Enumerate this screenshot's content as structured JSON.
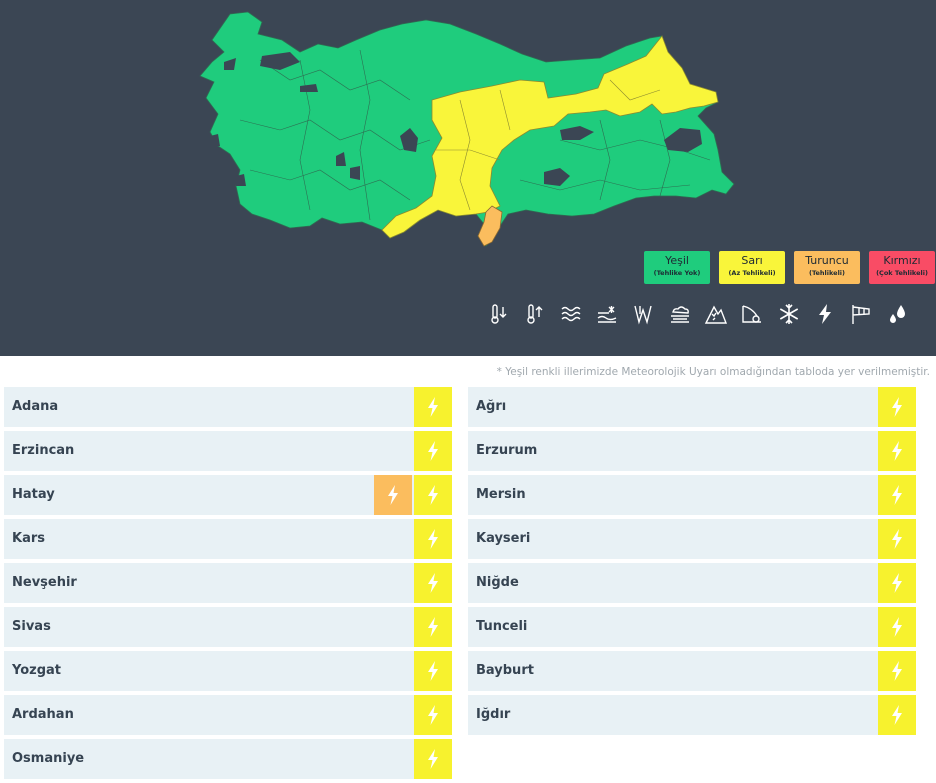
{
  "colors": {
    "panel": "#3b4654",
    "green": "#1fcc7d",
    "yellow": "#f9f53a",
    "orange": "#fbbd5e",
    "red": "#f94c65",
    "row_bg": "#e8f1f5"
  },
  "legend": [
    {
      "label": "Yeşil",
      "sub": "(Tehlike Yok)",
      "color": "#1fcc7d"
    },
    {
      "label": "Sarı",
      "sub": "(Az Tehlikeli)",
      "color": "#f9f53a"
    },
    {
      "label": "Turuncu",
      "sub": "(Tehlikeli)",
      "color": "#fbbd5e"
    },
    {
      "label": "Kırmızı",
      "sub": "(Çok Tehlikeli)",
      "color": "#f94c65"
    }
  ],
  "hazard_icons": [
    "cold-temperature-icon",
    "hot-temperature-icon",
    "wave-icon",
    "snow-melt-icon",
    "wind-icon",
    "fog-icon",
    "avalanche-icon",
    "dust-icon",
    "snow-icon",
    "thunderstorm-icon",
    "strong-wind-icon",
    "rain-icon"
  ],
  "note": "* Yeşil renkli illerimizde Meteorolojik Uyarı olmadığından tabloda yer verilmemiştir.",
  "provinces_left": [
    {
      "name": "Adana",
      "orange": false
    },
    {
      "name": "Erzincan",
      "orange": false
    },
    {
      "name": "Hatay",
      "orange": true
    },
    {
      "name": "Kars",
      "orange": false
    },
    {
      "name": "Nevşehir",
      "orange": false
    },
    {
      "name": "Sivas",
      "orange": false
    },
    {
      "name": "Yozgat",
      "orange": false
    },
    {
      "name": "Ardahan",
      "orange": false
    },
    {
      "name": "Osmaniye",
      "orange": false
    }
  ],
  "provinces_right": [
    {
      "name": "Ağrı",
      "orange": false
    },
    {
      "name": "Erzurum",
      "orange": false
    },
    {
      "name": "Mersin",
      "orange": false
    },
    {
      "name": "Kayseri",
      "orange": false
    },
    {
      "name": "Niğde",
      "orange": false
    },
    {
      "name": "Tunceli",
      "orange": false
    },
    {
      "name": "Bayburt",
      "orange": false
    },
    {
      "name": "Iğdır",
      "orange": false
    }
  ]
}
